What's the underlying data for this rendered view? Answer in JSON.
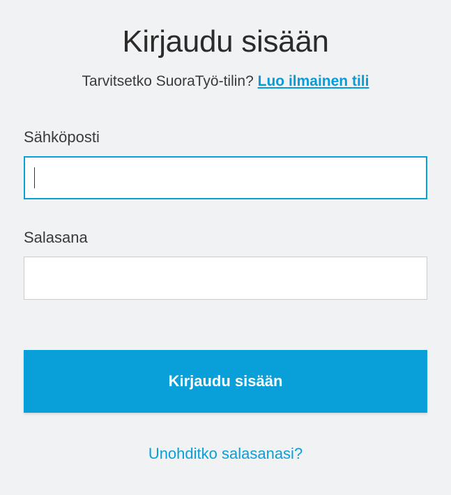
{
  "title": "Kirjaudu sisään",
  "subtitle_text": "Tarvitsetko SuoraTyö-tilin? ",
  "signup_link_text": "Luo ilmainen tili",
  "email": {
    "label": "Sähköposti",
    "value": ""
  },
  "password": {
    "label": "Salasana",
    "value": ""
  },
  "submit_label": "Kirjaudu sisään",
  "forgot_link_text": "Unohditko salasanasi?",
  "colors": {
    "accent": "#09a0d9",
    "background": "#f0f2f3",
    "text": "#3a3a3a"
  }
}
